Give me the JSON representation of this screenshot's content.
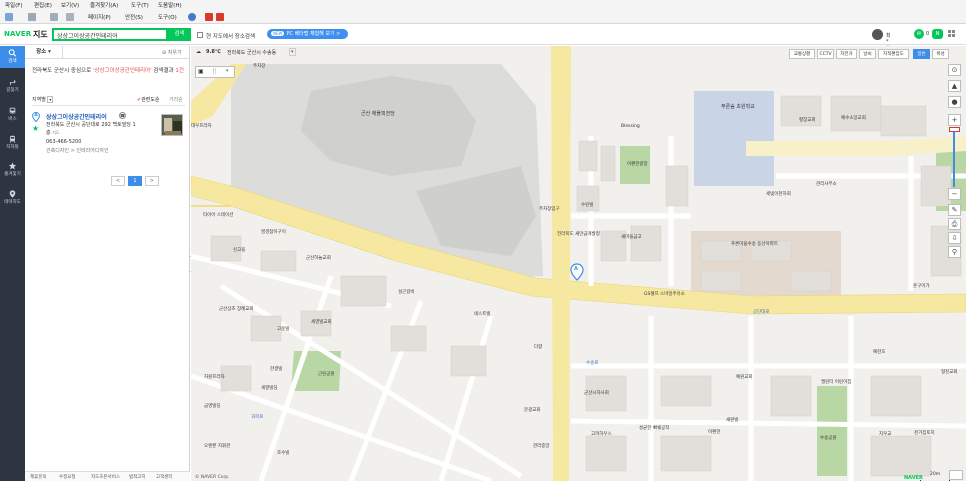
{
  "browser": {
    "menus": [
      "파일(F)",
      "편집(E)",
      "보기(V)",
      "즐겨찾기(A)",
      "도구(T)",
      "도움말(H)"
    ],
    "command_bar": [
      "페이지(P)",
      "안전(S)",
      "도구(O)"
    ]
  },
  "header": {
    "logo": "NAVER",
    "title": "지도",
    "search_value": "상상그이상공간인테리어",
    "search_button": "검색",
    "in_map_search_label": "현 지도에서 장소검색",
    "beta_banner_badge": "NEW",
    "beta_banner": "PC 베타맵 체험해 보기 >",
    "user_name": "최*원",
    "mail_count": "0",
    "app_badge": "N"
  },
  "left_nav": [
    {
      "label": "검색",
      "icon": "search-icon",
      "active": true
    },
    {
      "label": "길찾기",
      "icon": "directions-icon",
      "active": false
    },
    {
      "label": "버스",
      "icon": "bus-icon",
      "active": false
    },
    {
      "label": "지하철",
      "icon": "subway-icon",
      "active": false
    },
    {
      "label": "즐겨찾기",
      "icon": "star-icon",
      "active": false
    },
    {
      "label": "테마지도",
      "icon": "theme-map-pin-icon",
      "active": false
    }
  ],
  "panel": {
    "tab_label": "장소",
    "clear_label": "지우기",
    "result_prefix": "전라북도 군산시 중심으로 ",
    "result_query": "'상상그이상공간인테리어'",
    "result_mid": " 검색결과 ",
    "result_count": "1건",
    "filter_region": "지역별",
    "filter_sort": "관련도순",
    "filter_distance": "거리순",
    "result": {
      "marker": "A",
      "name": "상상그이상공간인테리어",
      "address": "전라북도 군산시 공단대로 292 백토빌딩 1층",
      "map_link": "지도",
      "phone": "063-466-5200",
      "category": "건축디자인 > 인테리어디자인"
    },
    "pagination": {
      "prev": "<",
      "current": "1",
      "next": ">"
    },
    "footer": [
      "제휴문의",
      "수정요청",
      "지도초본서비스",
      "법적고지",
      "고객센터"
    ]
  },
  "map": {
    "location_temp": "9.8℃",
    "location": "전라북도 군산시 수송동",
    "layer_tabs": [
      "교통상황",
      "CCTV",
      "자전거",
      "날씨",
      "지적편집도",
      "일반",
      "위성"
    ],
    "active_layer": "일반",
    "copyright": "© NAVER Corp.",
    "scale": "20m",
    "watermark": "NAVER",
    "pin_label": "A",
    "labels": [
      "주차장",
      "군산 애플피전당",
      "대우프라자",
      "Blessing",
      "푸른숲 초원학교",
      "평장교회",
      "예수소망교회",
      "이편한광장",
      "수린빌",
      "주차장입구",
      "전라북도 새만금개발청",
      "세빛이천하회",
      "관리사무소",
      "새마을금고",
      "푸른마을수송 동선아파트",
      "GS셀프 스마일주유소",
      "훈구이가",
      "타이어 스테이션",
      "영경참이구이",
      "신고을",
      "군산하늘교회",
      "설곤갈비",
      "네스트빌",
      "군산상조 장례교회",
      "세영빌교회",
      "고운빌",
      "한결빌",
      "다향",
      "공단대로",
      "근린공원",
      "자원프라자",
      "세향빌딩",
      "금영빌딩",
      "조수빌",
      "문광교회",
      "군산시하사회",
      "고려하우스",
      "성균한 빠쉐공작",
      "관리중앙",
      "예원교회",
      "새원빌",
      "엘린터 어린이집",
      "예찬호",
      "이편한",
      "형진교회",
      "지우교",
      "오렌쭌 지휘관",
      "수송공원",
      "천가집토지",
      "수송로",
      "과학로"
    ]
  },
  "colors": {
    "naver_green": "#03c75a",
    "nav_bg": "#2d3540",
    "accent_blue": "#3c8ee8",
    "highlight_red": "#e64747"
  }
}
